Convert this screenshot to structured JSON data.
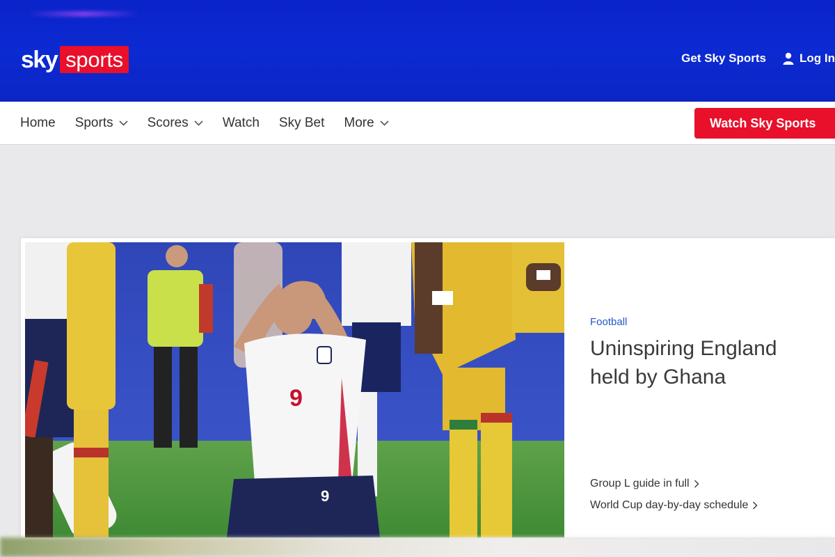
{
  "header": {
    "logo_sky": "sky",
    "logo_sports": "sports",
    "get_sky_sports": "Get Sky Sports",
    "log_in": "Log In"
  },
  "nav": {
    "items": [
      {
        "label": "Home",
        "dropdown": false
      },
      {
        "label": "Sports",
        "dropdown": true
      },
      {
        "label": "Scores",
        "dropdown": true
      },
      {
        "label": "Watch",
        "dropdown": false
      },
      {
        "label": "Sky Bet",
        "dropdown": false
      },
      {
        "label": "More",
        "dropdown": true
      }
    ],
    "cta": "Watch Sky Sports"
  },
  "hero": {
    "category": "Football",
    "headline": "Uninspiring England held by Ghana",
    "links": [
      {
        "label": "Group L guide in full"
      },
      {
        "label": "World Cup day-by-day schedule"
      }
    ]
  },
  "colors": {
    "header_blue": "#0b26c4",
    "brand_red": "#e8102a",
    "kicker_blue": "#2456c6"
  }
}
